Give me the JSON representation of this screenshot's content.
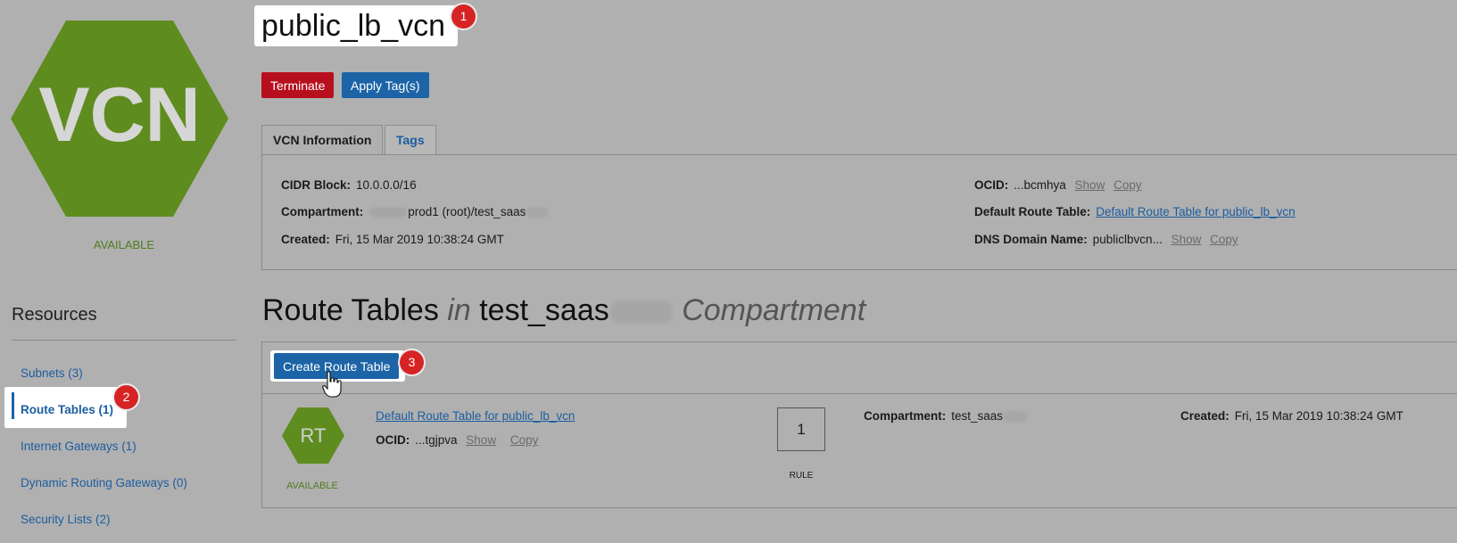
{
  "vcn": {
    "logo_text": "VCN",
    "status": "AVAILABLE",
    "title": "public_lb_vcn",
    "buttons": {
      "terminate": "Terminate",
      "apply_tags": "Apply Tag(s)"
    },
    "tabs": [
      "VCN Information",
      "Tags"
    ],
    "info": {
      "cidr_label": "CIDR Block:",
      "cidr_value": "10.0.0.0/16",
      "compartment_label": "Compartment:",
      "compartment_value_a": "prod1 (root)/test_saas",
      "created_label": "Created:",
      "created_value": "Fri, 15 Mar 2019 10:38:24 GMT",
      "ocid_label": "OCID:",
      "ocid_value": "...bcmhya",
      "show": "Show",
      "copy": "Copy",
      "route_table_label": "Default Route Table:",
      "route_table_value": "Default Route Table for public_lb_vcn",
      "dns_label": "DNS Domain Name:",
      "dns_value": "publiclbvcn..."
    }
  },
  "badges": [
    "1",
    "2",
    "3"
  ],
  "resources": {
    "heading": "Resources",
    "items": [
      {
        "label": "Subnets (3)"
      },
      {
        "label": "Route Tables (1)"
      },
      {
        "label": "Internet Gateways (1)"
      },
      {
        "label": "Dynamic Routing Gateways (0)"
      },
      {
        "label": "Security Lists (2)"
      }
    ]
  },
  "route_tables": {
    "title_a": "Route Tables",
    "title_in": "in",
    "title_b": "test_saas",
    "title_c": "Compartment",
    "create_button": "Create Route Table",
    "row": {
      "icon_text": "RT",
      "status": "AVAILABLE",
      "name": "Default Route Table for public_lb_vcn",
      "ocid_label": "OCID:",
      "ocid_value": "...tgjpva",
      "show": "Show",
      "copy": "Copy",
      "rule_count": "1",
      "rule_label": "RULE",
      "compartment_label": "Compartment:",
      "compartment_value": "test_saas",
      "created_label": "Created:",
      "created_value": "Fri, 15 Mar 2019 10:38:24 GMT"
    }
  },
  "colors": {
    "vcn_green": "#5f8c1f",
    "primary_blue": "#1c64a6",
    "danger_red": "#b70f1e",
    "badge_red": "#d62424"
  }
}
